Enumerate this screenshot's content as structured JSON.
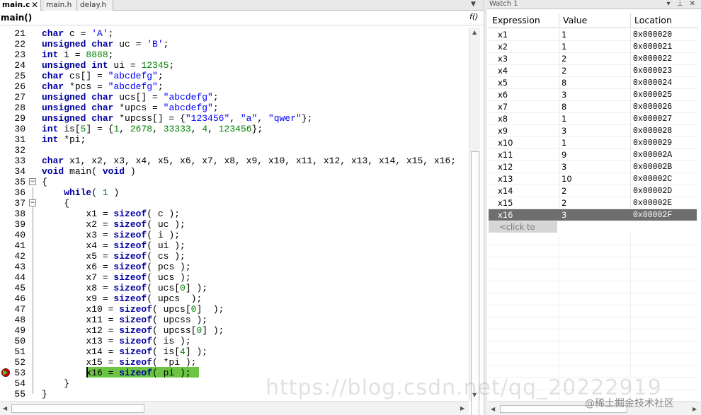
{
  "tabs": [
    {
      "label": "main.c",
      "active": true
    },
    {
      "label": "main.h",
      "active": false
    },
    {
      "label": "delay.h",
      "active": false
    }
  ],
  "tab_close_glyph": "✕",
  "function_bar": {
    "name": "main()",
    "icon": "f()"
  },
  "code_lines": [
    {
      "n": "21",
      "html": "<span class=\"kw\">char</span> c = <span class=\"str\">'A'</span>;"
    },
    {
      "n": "22",
      "html": "<span class=\"kw\">unsigned char</span> uc = <span class=\"str\">'B'</span>;"
    },
    {
      "n": "23",
      "html": "<span class=\"kw\">int</span> i = <span class=\"num\">8888</span>;"
    },
    {
      "n": "24",
      "html": "<span class=\"kw\">unsigned int</span> ui = <span class=\"num\">12345</span>;"
    },
    {
      "n": "25",
      "html": "<span class=\"kw\">char</span> cs[] = <span class=\"str\">\"abcdefg\"</span>;"
    },
    {
      "n": "26",
      "html": "<span class=\"kw\">char</span> *pcs = <span class=\"str\">\"abcdefg\"</span>;"
    },
    {
      "n": "27",
      "html": "<span class=\"kw\">unsigned char</span> ucs[] = <span class=\"str\">\"abcdefg\"</span>;"
    },
    {
      "n": "28",
      "html": "<span class=\"kw\">unsigned char</span> *upcs = <span class=\"str\">\"abcdefg\"</span>;"
    },
    {
      "n": "29",
      "html": "<span class=\"kw\">unsigned char</span> *upcss[] = {<span class=\"str\">\"123456\"</span>, <span class=\"str\">\"a\"</span>, <span class=\"str\">\"qwer\"</span>};"
    },
    {
      "n": "30",
      "html": "<span class=\"kw\">int</span> is[<span class=\"num\">5</span>] = {<span class=\"num\">1</span>, <span class=\"num\">2678</span>, <span class=\"num\">33333</span>, <span class=\"num\">4</span>, <span class=\"num\">123456</span>};"
    },
    {
      "n": "31",
      "html": "<span class=\"kw\">int</span> *pi;"
    },
    {
      "n": "32",
      "html": ""
    },
    {
      "n": "33",
      "html": "<span class=\"kw\">char</span> x1, x2, x3, x4, x5, x6, x7, x8, x9, x10, x11, x12, x13, x14, x15, x16;"
    },
    {
      "n": "34",
      "html": "<span class=\"kw\">void</span> main( <span class=\"kw\">void</span> )"
    },
    {
      "n": "35",
      "html": "{"
    },
    {
      "n": "36",
      "html": "    <span class=\"kw\">while</span>( <span class=\"num\">1</span> )"
    },
    {
      "n": "37",
      "html": "    {"
    },
    {
      "n": "38",
      "html": "        x1 = <span class=\"kw\">sizeof</span>( c );"
    },
    {
      "n": "39",
      "html": "        x2 = <span class=\"kw\">sizeof</span>( uc );"
    },
    {
      "n": "40",
      "html": "        x3 = <span class=\"kw\">sizeof</span>( i );"
    },
    {
      "n": "41",
      "html": "        x4 = <span class=\"kw\">sizeof</span>( ui );"
    },
    {
      "n": "42",
      "html": "        x5 = <span class=\"kw\">sizeof</span>( cs );"
    },
    {
      "n": "43",
      "html": "        x6 = <span class=\"kw\">sizeof</span>( pcs );"
    },
    {
      "n": "44",
      "html": "        x7 = <span class=\"kw\">sizeof</span>( ucs );"
    },
    {
      "n": "45",
      "html": "        x8 = <span class=\"kw\">sizeof</span>( ucs[<span class=\"num\">0</span>] );"
    },
    {
      "n": "46",
      "html": "        x9 = <span class=\"kw\">sizeof</span>( upcs  );"
    },
    {
      "n": "47",
      "html": "        x10 = <span class=\"kw\">sizeof</span>( upcs[<span class=\"num\">0</span>]  );"
    },
    {
      "n": "48",
      "html": "        x11 = <span class=\"kw\">sizeof</span>( upcss );"
    },
    {
      "n": "49",
      "html": "        x12 = <span class=\"kw\">sizeof</span>( upcss[<span class=\"num\">0</span>] );"
    },
    {
      "n": "50",
      "html": "        x13 = <span class=\"kw\">sizeof</span>( is );"
    },
    {
      "n": "51",
      "html": "        x14 = <span class=\"kw\">sizeof</span>( is[<span class=\"num\">4</span>] );"
    },
    {
      "n": "52",
      "html": "        x15 = <span class=\"kw\">sizeof</span>( *pi );"
    },
    {
      "n": "53",
      "html": "        x16 = <span class=\"kw\">sizeof</span>( pi );"
    },
    {
      "n": "54",
      "html": "    }"
    },
    {
      "n": "55",
      "html": "}"
    }
  ],
  "watch": {
    "title": "Watch 1",
    "title_buttons": "▾ ⊥ ✕",
    "columns": [
      "Expression",
      "Value",
      "Location"
    ],
    "rows": [
      {
        "exp": "x1",
        "val": "1",
        "loc": "0x000020"
      },
      {
        "exp": "x2",
        "val": "1",
        "loc": "0x000021"
      },
      {
        "exp": "x3",
        "val": "2",
        "loc": "0x000022"
      },
      {
        "exp": "x4",
        "val": "2",
        "loc": "0x000023"
      },
      {
        "exp": "x5",
        "val": "8",
        "loc": "0x000024"
      },
      {
        "exp": "x6",
        "val": "3",
        "loc": "0x000025"
      },
      {
        "exp": "x7",
        "val": "8",
        "loc": "0x000026"
      },
      {
        "exp": "x8",
        "val": "1",
        "loc": "0x000027"
      },
      {
        "exp": "x9",
        "val": "3",
        "loc": "0x000028"
      },
      {
        "exp": "x10",
        "val": "1",
        "loc": "0x000029"
      },
      {
        "exp": "x11",
        "val": "9",
        "loc": "0x00002A"
      },
      {
        "exp": "x12",
        "val": "3",
        "loc": "0x00002B"
      },
      {
        "exp": "x13",
        "val": "10",
        "loc": "0x00002C"
      },
      {
        "exp": "x14",
        "val": "2",
        "loc": "0x00002D"
      },
      {
        "exp": "x15",
        "val": "2",
        "loc": "0x00002E"
      },
      {
        "exp": "x16",
        "val": "3",
        "loc": "0x00002F",
        "selected": true
      }
    ],
    "add_placeholder": "<click to add>"
  },
  "watermark": "https://blog.csdn.net/qq_20222919",
  "credit": "@稀土掘金技术社区",
  "colors": {
    "current_line": "#6bc543",
    "keyword": "#0000a0",
    "number": "#008000",
    "string": "#0000ff",
    "selected_row": "#6e6e6e"
  }
}
